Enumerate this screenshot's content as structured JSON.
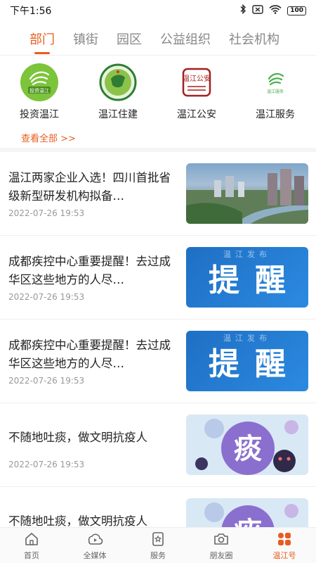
{
  "status": {
    "time": "下午1:56",
    "battery": "100"
  },
  "tabs": [
    {
      "label": "部门",
      "active": true
    },
    {
      "label": "镇街",
      "active": false
    },
    {
      "label": "园区",
      "active": false
    },
    {
      "label": "公益组织",
      "active": false
    },
    {
      "label": "社会机构",
      "active": false
    }
  ],
  "accounts": [
    {
      "name": "投资温江",
      "logo_text": "投资温江"
    },
    {
      "name": "温江住建"
    },
    {
      "name": "温江公安",
      "logo_text": "温江公安"
    },
    {
      "name": "温江服务",
      "logo_text": "温江服务"
    }
  ],
  "see_all": "查看全部 >>",
  "news": [
    {
      "title": "温江两家企业入选！四川首批省级新型研发机构拟备…",
      "date": "2022-07-26 19:53",
      "thumb": "city"
    },
    {
      "title": "成都疾控中心重要提醒！去过成华区这些地方的人尽…",
      "date": "2022-07-26 19:53",
      "thumb": "remind",
      "thumb_small": "温江发布",
      "thumb_big": "提醒"
    },
    {
      "title": "成都疾控中心重要提醒！去过成华区这些地方的人尽…",
      "date": "2022-07-26 19:53",
      "thumb": "remind",
      "thumb_small": "温江发布",
      "thumb_big": "提醒"
    },
    {
      "title": "不随地吐痰，做文明抗疫人",
      "date": "2022-07-26 19:53",
      "thumb": "virus",
      "thumb_big": "痰"
    },
    {
      "title": "不随地吐痰，做文明抗疫人",
      "date": "",
      "thumb": "virus",
      "thumb_big": "痰"
    }
  ],
  "nav": [
    {
      "label": "首页",
      "icon": "home-icon",
      "active": false
    },
    {
      "label": "全媒体",
      "icon": "media-icon",
      "active": false
    },
    {
      "label": "服务",
      "icon": "service-icon",
      "active": false
    },
    {
      "label": "朋友圈",
      "icon": "camera-icon",
      "active": false
    },
    {
      "label": "温江号",
      "icon": "apps-icon",
      "active": true
    }
  ],
  "colors": {
    "accent": "#e85d1e",
    "logo_green": "#7cc43a",
    "remind_blue": "#1f6fc4"
  }
}
